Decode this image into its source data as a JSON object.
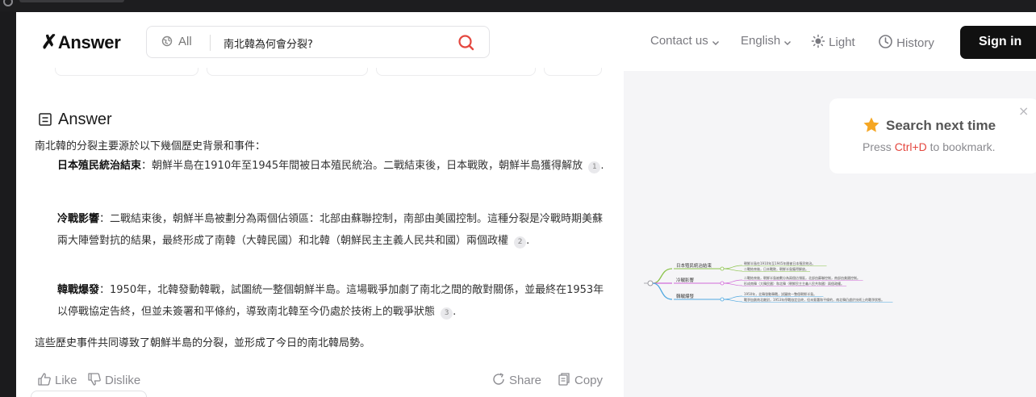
{
  "header": {
    "logo": "Answer",
    "search_scope": "All",
    "search_query": "南北韓為何會分裂?",
    "contact": "Contact us",
    "language": "English",
    "theme": "Light",
    "history": "History",
    "sign_in": "Sign in"
  },
  "answer": {
    "heading": "Answer",
    "intro": "南北韓的分裂主要源於以下幾個歷史背景和事件：",
    "points": [
      {
        "title": "日本殖民統治結束",
        "body": "：朝鮮半島在1910年至1945年間被日本殖民統治。二戰結束後，日本戰敗，朝鮮半島獲得解放",
        "cite": "1"
      },
      {
        "title": "冷戰影響",
        "body": "：二戰結束後，朝鮮半島被劃分為兩個佔領區：北部由蘇聯控制，南部由美國控制。這種分裂是冷戰時期美蘇兩大陣營對抗的結果，最終形成了南韓（大韓民國）和北韓（朝鮮民主主義人民共和國）兩個政權",
        "cite": "2"
      },
      {
        "title": "韓戰爆發",
        "body": "：1950年，北韓發動韓戰，試圖統一整個朝鮮半島。這場戰爭加劇了南北之間的敵對關係，並最終在1953年以停戰協定告終，但並未簽署和平條約，導致南北韓至今仍處於技術上的戰爭狀態",
        "cite": "3"
      }
    ],
    "outro": "這些歷史事件共同導致了朝鮮半島的分裂，並形成了今日的南北韓局勢。",
    "actions": {
      "like": "Like",
      "dislike": "Dislike",
      "share": "Share",
      "copy": "Copy"
    }
  },
  "toast": {
    "title": "Search next time",
    "press": "Press ",
    "key": "Ctrl+D",
    "suffix": " to bookmark.",
    "close": "×"
  },
  "mindmap": {
    "branches": [
      {
        "label": "日本殖民統治結束",
        "color": "#8bc34a",
        "leaves": [
          "朝鮮半島在1910年至1945年間被日本殖民統治。",
          "二戰結束後，日本戰敗，朝鮮半島獲得解放。"
        ]
      },
      {
        "label": "冷戰影響",
        "color": "#d16ad8",
        "leaves": [
          "二戰結束後，朝鮮半島被劃分為兩個佔領區，北部由蘇聯控制，南部由美國控制。",
          "形成南韓（大韓民國）和北韓（朝鮮民主主義人民共和國）兩個政權。"
        ]
      },
      {
        "label": "韓戰爆發",
        "color": "#4fa8e0",
        "leaves": [
          "1950年，北韓發動韓戰，試圖統一整個朝鮮半島。",
          "戰爭加劇南北敵對，1953年停戰協定告終，但未簽署和平條約，南北韓仍處於技術上的戰爭狀態。"
        ]
      }
    ]
  },
  "colors": {
    "accent": "#e4473f",
    "dark": "#111111",
    "star": "#f5a623"
  }
}
